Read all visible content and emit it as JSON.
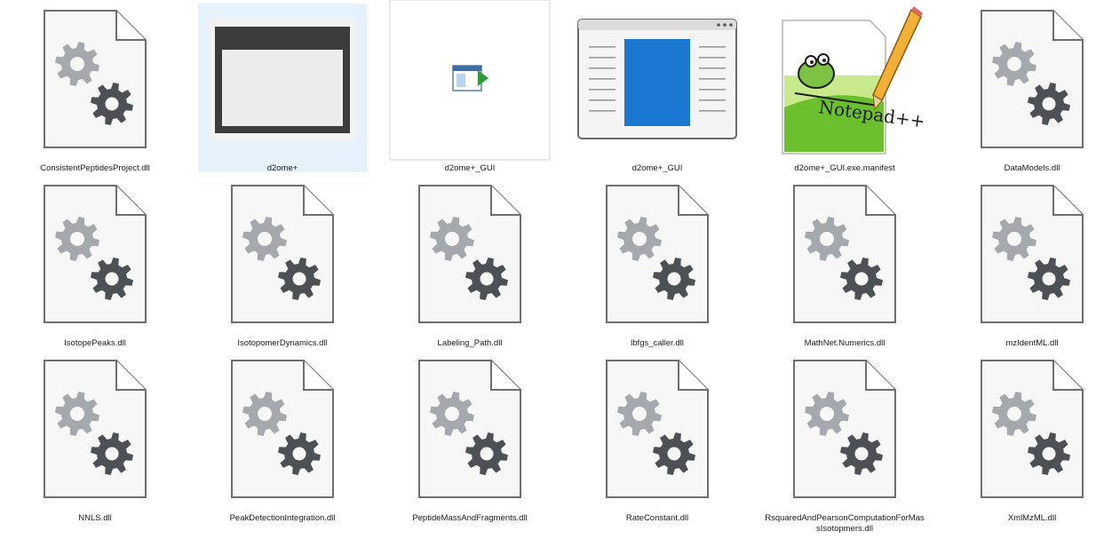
{
  "files": [
    {
      "name": "ConsistentPeptidesProject.dll",
      "icon": "dll-file-icon"
    },
    {
      "name": "d2ome+",
      "icon": "folder-preview-icon",
      "selected": true
    },
    {
      "name": "d2ome+_GUI",
      "icon": "app-exe-icon"
    },
    {
      "name": "d2ome+_GUI",
      "icon": "app-window-icon"
    },
    {
      "name": "d2ome+_GUI.exe.manifest",
      "icon": "notepad-plus-plus-icon"
    },
    {
      "name": "DataModels.dll",
      "icon": "dll-file-icon"
    },
    {
      "name": "IsotopePeaks.dll",
      "icon": "dll-file-icon"
    },
    {
      "name": "IsotopomerDynamics.dll",
      "icon": "dll-file-icon"
    },
    {
      "name": "Labeling_Path.dll",
      "icon": "dll-file-icon"
    },
    {
      "name": "lbfgs_caller.dll",
      "icon": "dll-file-icon"
    },
    {
      "name": "MathNet.Numerics.dll",
      "icon": "dll-file-icon"
    },
    {
      "name": "mzIdentML.dll",
      "icon": "dll-file-icon"
    },
    {
      "name": "NNLS.dll",
      "icon": "dll-file-icon"
    },
    {
      "name": "PeakDetectionIntegration.dll",
      "icon": "dll-file-icon"
    },
    {
      "name": "PeptideMassAndFragments.dll",
      "icon": "dll-file-icon"
    },
    {
      "name": "RateConstant.dll",
      "icon": "dll-file-icon"
    },
    {
      "name": "RsquaredAndPearsonComputationForMassIsotopmers.dll",
      "icon": "dll-file-icon"
    },
    {
      "name": "XmlMzML.dll",
      "icon": "dll-file-icon"
    }
  ],
  "colors": {
    "selection": "#e5f1fb",
    "gear_light": "#a5a8ad",
    "gear_dark": "#4d5156",
    "window_frame": "#3c3c3c",
    "window_blue": "#1a78d3",
    "notepad_green": "#6cc02e"
  }
}
